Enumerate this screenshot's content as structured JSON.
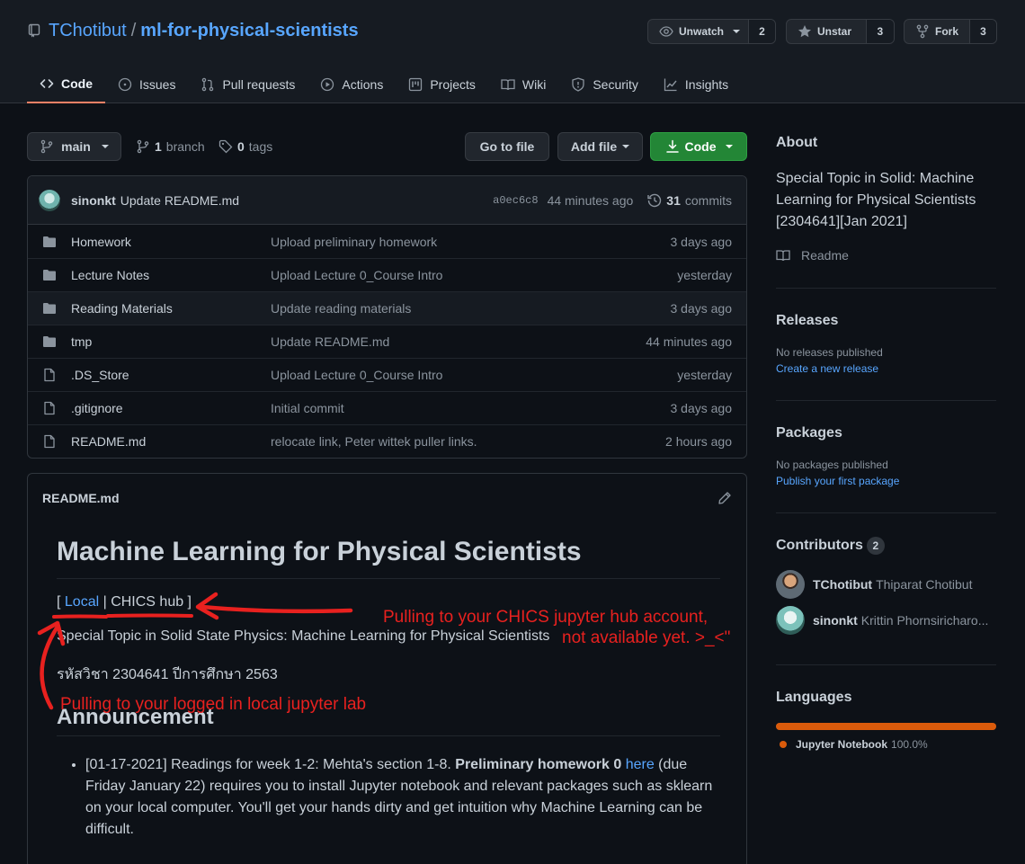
{
  "repo": {
    "owner": "TChotibut",
    "separator": "/",
    "name": "ml-for-physical-scientists"
  },
  "actions": [
    {
      "label": "Unwatch",
      "count": "2",
      "icon": "eye-icon"
    },
    {
      "label": "Unstar",
      "count": "3",
      "icon": "star-icon"
    },
    {
      "label": "Fork",
      "count": "3",
      "icon": "fork-icon"
    }
  ],
  "tabs": [
    {
      "label": "Code",
      "icon": "code-icon",
      "selected": true
    },
    {
      "label": "Issues",
      "icon": "issue-icon"
    },
    {
      "label": "Pull requests",
      "icon": "pull-request-icon"
    },
    {
      "label": "Actions",
      "icon": "play-icon"
    },
    {
      "label": "Projects",
      "icon": "project-icon"
    },
    {
      "label": "Wiki",
      "icon": "book-icon"
    },
    {
      "label": "Security",
      "icon": "shield-icon"
    },
    {
      "label": "Insights",
      "icon": "graph-icon"
    }
  ],
  "toolbar": {
    "branch": "main",
    "branch_count": "1",
    "branch_word": "branch",
    "tag_count": "0",
    "tag_word": "tags",
    "go_to_file": "Go to file",
    "add_file": "Add file",
    "code": "Code"
  },
  "latest_commit": {
    "author": "sinonkt",
    "message": "Update README.md",
    "sha": "a0ec6c8",
    "time": "44 minutes ago",
    "commit_count": "31",
    "commit_word": "commits"
  },
  "files": [
    {
      "type": "folder",
      "name": "Homework",
      "message": "Upload preliminary homework",
      "age": "3 days ago"
    },
    {
      "type": "folder",
      "name": "Lecture Notes",
      "message": "Upload Lecture 0_Course Intro",
      "age": "yesterday"
    },
    {
      "type": "folder",
      "name": "Reading Materials",
      "message": "Update reading materials",
      "age": "3 days ago"
    },
    {
      "type": "folder",
      "name": "tmp",
      "message": "Update README.md",
      "age": "44 minutes ago"
    },
    {
      "type": "file",
      "name": ".DS_Store",
      "message": "Upload Lecture 0_Course Intro",
      "age": "yesterday"
    },
    {
      "type": "file",
      "name": ".gitignore",
      "message": "Initial commit",
      "age": "3 days ago"
    },
    {
      "type": "file",
      "name": "README.md",
      "message": "relocate link, Peter wittek puller links.",
      "age": "2 hours ago"
    }
  ],
  "readme": {
    "filename": "README.md",
    "h1": "Machine Learning for Physical Scientists",
    "links": {
      "open": "[ ",
      "local": "Local",
      "divider": " | ",
      "hub": "CHICS hub",
      "close": " ]"
    },
    "subtitle": "Special Topic in Solid State Physics: Machine Learning for Physical Scientists",
    "course": "รหัสวิชา 2304641 ปีการศึกษา 2563",
    "h2": "Announcement",
    "item": {
      "pre": "[01-17-2021] Readings for week 1-2: Mehta's section 1-8. ",
      "bold": "Preliminary homework 0",
      "space": " ",
      "link": "here",
      "post": " (due Friday January 22) requires you to install Jupyter notebook and relevant packages such as sklearn on your local computer. You'll get your hands dirty and get intuition why Machine Learning can be difficult."
    }
  },
  "annotations": {
    "hub_line1": "Pulling to your CHICS jupyter hub account,",
    "hub_line2": "not available yet. >_<\"",
    "local": "Pulling to your logged in local jupyter lab",
    "color": "#e8211f"
  },
  "sidebar": {
    "about_title": "About",
    "about_desc": "Special Topic in Solid: Machine Learning for Physical Scientists [2304641][Jan 2021]",
    "readme_link": "Readme",
    "releases_title": "Releases",
    "releases_none": "No releases published",
    "releases_link": "Create a new release",
    "packages_title": "Packages",
    "packages_none": "No packages published",
    "packages_link": "Publish your first package",
    "contributors_title": "Contributors",
    "contributors_count": "2",
    "contributors": [
      {
        "login": "TChotibut",
        "name": "Thiparat Chotibut"
      },
      {
        "login": "sinonkt",
        "name": "Krittin Phornsiricharo..."
      }
    ],
    "languages_title": "Languages",
    "languages": [
      {
        "name": "Jupyter Notebook",
        "percent": "100.0%",
        "share": 1.0,
        "color": "#DA5B0B"
      }
    ]
  },
  "colors": {
    "background": "#0d1117",
    "link": "#58a6ff",
    "primary_button": "#238636",
    "tab_underline": "#f78166"
  }
}
